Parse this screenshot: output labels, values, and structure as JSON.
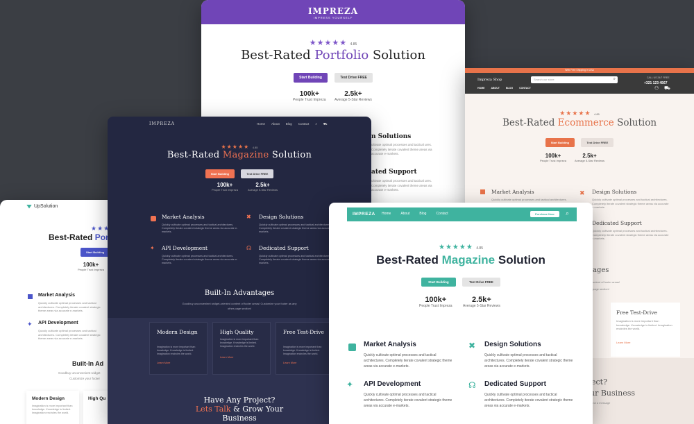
{
  "purple": {
    "logo": "IMPREZA",
    "tagline": "IMPRESS YOURSELF",
    "stars": "★★★★★",
    "rating": "4.85",
    "title_pre": "Best-Rated ",
    "title_hl": "Portfolio",
    "title_post": " Solution",
    "btn1": "Start Building",
    "btn2": "Test Drive FREE",
    "stat1_n": "100k+",
    "stat1_l": "People Trust Impreza",
    "stat2_n": "2.5k+",
    "stat2_l": "Average 5-Star Reviews"
  },
  "ecom": {
    "topbar": "Web Free Shipping in USA",
    "shop": "Impreza Shop",
    "search": "Search our store",
    "call_label": "CALL US 24/7 FREE",
    "phone": "+321 123 4567",
    "nav": [
      "HOME",
      "ABOUT",
      "BLOG",
      "CONTACT"
    ],
    "stars": "★★★★★",
    "rating": "4.85",
    "title_pre": "Best-Rated ",
    "title_hl": "Ecommerce",
    "title_post": " Solution",
    "btn1": "Start Building",
    "btn2": "Test Drive FREE",
    "stat1_n": "100k+",
    "stat1_l": "People Trust Impreza",
    "stat2_n": "2.5k+",
    "stat2_l": "Average 5-Star Reviews",
    "f1": "Market Analysis",
    "f2": "Design Solutions",
    "f4": "Dedicated Support",
    "desc": "Quickly cultivate optimal processes and tactical architectures. Completely iterate covalent strategic theme areas via accurate e-markets.",
    "adv": "ages",
    "adv_desc1": "ontent of footer areas!",
    "adv_desc2": "page section!",
    "free_title": "Free Test-Drive",
    "free_desc": "Imagination is more important than knowledge. Knowledge is limited. Imagination encircles the world.",
    "learn": "Learn More",
    "proj": "ect?",
    "biz": "ur Business",
    "msg": "and a message"
  },
  "ups": {
    "logo": "UpSolution",
    "stars": "★★★",
    "title_pre": "Best-Rated ",
    "title_hl": "Por",
    "btn1": "Start Building",
    "stat_n": "100k+",
    "stat_l": "People Trust Impreza",
    "f1": "Market Analysis",
    "f2": "API Development",
    "desc": "Quickly cultivate optimal processes and tactical architectures. Completely iterate covalent strategic theme areas via accurate e-markets.",
    "adv": "Built-In Ad",
    "adv_desc": "Goodbuy unconvenient widget",
    "adv_desc2": "Customize your footer",
    "m1": "Modern Design",
    "m2": "High Qu",
    "m_desc": "Imagination is more important than knowledge. Knowledge is limited. Imagination encircles the world."
  },
  "purple_features": {
    "f1": "n Solutions",
    "f2": "ated Support",
    "desc": "ultivate optimal processes and tactical ures. Completely iterate covalent theme areas via accurate e-markets."
  },
  "dark": {
    "logo": "IMPREZA",
    "nav": [
      "Home",
      "About",
      "Blog",
      "Contact"
    ],
    "stars": "★★★★★",
    "rating": "4.85",
    "title_pre": "Best-Rated ",
    "title_hl": "Magazine",
    "title_post": " Solution",
    "btn1": "Start Building",
    "btn2": "Test Drive FREE",
    "stat1_n": "100k+",
    "stat1_l": "People Trust Impreza",
    "stat2_n": "2.5k+",
    "stat2_l": "Average 5-Star Reviews",
    "f1": "Market Analysis",
    "f2": "Design Solutions",
    "f3": "API Development",
    "f4": "Dedicated Support",
    "desc": "Quickly cultivate optimal processes and tactical architectures. Completely iterate covalent strategic theme areas via accurate e-markets.",
    "adv": "Built-In Advantages",
    "adv_desc": "Goodbuy unconvenient widget-oriented content of footer areas! Customize your footer as any other page section!",
    "m1": "Modern Design",
    "m2": "High Quality",
    "m3": "Free Test-Drive",
    "m_desc": "Imagination is more important than knowledge. Knowledge is limited. Imagination encircles the world.",
    "learn": "Learn More",
    "cta1": "Have Any Project?",
    "cta2_hl": "Lets Talk",
    "cta2_post": " & Grow Your",
    "cta3": "Business"
  },
  "teal": {
    "logo": "IMPREZA",
    "nav": [
      "Home",
      "About",
      "Blog",
      "Contact"
    ],
    "purchase": "Purchase Now",
    "stars": "★★★★★",
    "rating": "4.85",
    "title_pre": "Best-Rated ",
    "title_hl": "Magazine",
    "title_post": " Solution",
    "btn1": "Start Building",
    "btn2": "Test Drive FREE",
    "stat1_n": "100k+",
    "stat1_l": "People Trust Impreza",
    "stat2_n": "2.5k+",
    "stat2_l": "Average 5-Star Reviews",
    "f1": "Market Analysis",
    "f2": "Design Solutions",
    "f3": "API Development",
    "f4": "Dedicated Support",
    "desc": "Quickly cultivate optimal processes and tactical architectures. Completely iterate covalent strategic theme areas via accurate e-markets."
  },
  "colors": {
    "purple": "#7045b7",
    "orange": "#e8734a",
    "teal": "#3fb39f",
    "dark": "#232741",
    "bg": "#3b3e44"
  }
}
